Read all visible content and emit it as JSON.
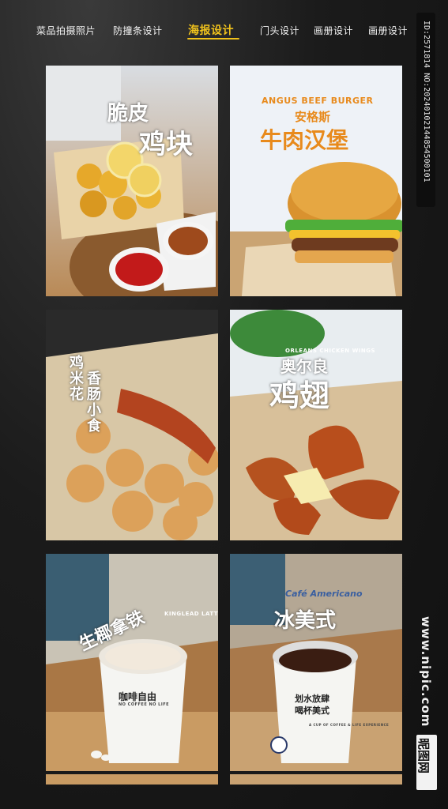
{
  "nav": {
    "items": [
      {
        "label": "菜品拍摄照片",
        "active": false
      },
      {
        "label": "防撞条设计",
        "active": false
      },
      {
        "label": "海报设计",
        "active": true
      },
      {
        "label": "门头设计",
        "active": false
      },
      {
        "label": "画册设计",
        "active": false
      },
      {
        "label": "画册设计",
        "active": false
      }
    ]
  },
  "watermark": {
    "id_text": "ID:2571814 NO:20240102144854500101",
    "site_url": "www.nipic.com",
    "site_logo": "昵图网"
  },
  "posters": [
    {
      "title_line1": "脆皮",
      "title_line2": "鸡块"
    },
    {
      "subtitle_en": "ANGUS BEEF BURGER",
      "subtitle_cn": "安格斯",
      "title": "牛肉汉堡"
    },
    {
      "title_col1": "鸡米花",
      "title_col2": "香肠小食"
    },
    {
      "subtitle_en": "ORLEANS CHICKEN WINGS",
      "title_line1": "奥尔良",
      "title_line2": "鸡翅"
    },
    {
      "title": "生椰拿铁",
      "subtitle_en": "KINGLEAD LATTE",
      "cup_text": "咖啡自由",
      "cup_sub": "NO COFFEE NO LIFE"
    },
    {
      "subtitle_en": "Café Americano",
      "title": "冰美式",
      "cup_text1": "划水放肆",
      "cup_text2": "喝杯美式",
      "cup_sub": "A CUP OF COFFEE & LIFE EXPERIENCE"
    }
  ],
  "colors": {
    "accent": "#f0c21c",
    "background": "#161616",
    "burger_title": "#e88a1c"
  }
}
